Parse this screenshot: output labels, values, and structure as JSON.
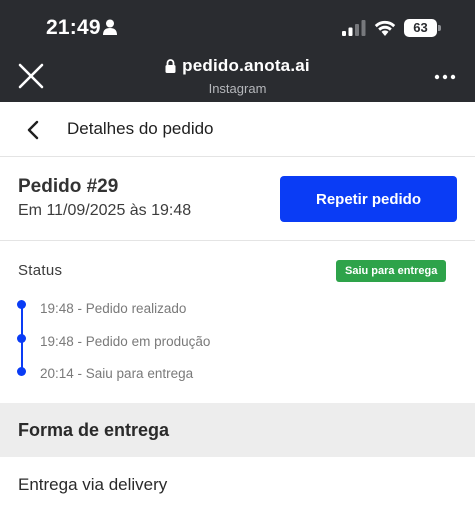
{
  "status_bar": {
    "time": "21:49",
    "battery": "63"
  },
  "browser": {
    "url": "pedido.anota.ai",
    "source": "Instagram"
  },
  "header": {
    "title": "Detalhes do pedido"
  },
  "order": {
    "title": "Pedido #29",
    "date": "Em 11/09/2025 às 19:48",
    "repeat_label": "Repetir pedido"
  },
  "status": {
    "label": "Status",
    "badge": "Saiu para entrega",
    "steps": [
      {
        "text": "19:48 - Pedido realizado"
      },
      {
        "text": "19:48 - Pedido em produção"
      },
      {
        "text": "20:14 - Saiu para entrega"
      }
    ]
  },
  "delivery": {
    "section_title": "Forma de entrega",
    "method": "Entrega via delivery"
  },
  "colors": {
    "accent": "#0a3cf5",
    "badge": "#2ea34a",
    "topbar": "#2a2c30"
  }
}
